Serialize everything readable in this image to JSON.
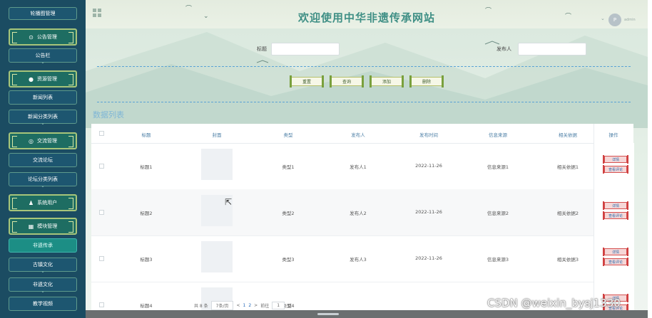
{
  "header": {
    "title": "欢迎使用中华非遗传承网站",
    "avatar_text": "P",
    "user_label": "admin"
  },
  "sidebar": {
    "items": [
      {
        "label": "轮播图管理",
        "type": "item"
      },
      {
        "label": "公告管理",
        "type": "group",
        "icon": "clock-icon"
      },
      {
        "label": "公告栏",
        "type": "item"
      },
      {
        "label": "资源管理",
        "type": "group",
        "icon": "location-pin-icon"
      },
      {
        "label": "新闻列表",
        "type": "item"
      },
      {
        "label": "新闻分类列表",
        "type": "item"
      },
      {
        "label": "交流管理",
        "type": "group",
        "icon": "chat-icon"
      },
      {
        "label": "交流论坛",
        "type": "item"
      },
      {
        "label": "论坛分类列表",
        "type": "item"
      },
      {
        "label": "系统用户",
        "type": "group",
        "icon": "user-icon"
      },
      {
        "label": "模块管理",
        "type": "group",
        "icon": "grid-icon"
      },
      {
        "label": "非遗传承",
        "type": "item",
        "active": true
      },
      {
        "label": "古镇文化",
        "type": "item"
      },
      {
        "label": "非遗文化",
        "type": "item"
      },
      {
        "label": "教学视频",
        "type": "item"
      }
    ]
  },
  "search": {
    "title_label": "标题",
    "title_value": "",
    "publisher_label": "发布人",
    "publisher_value": ""
  },
  "toolbar": {
    "reset_label": "重置",
    "search_label": "查询",
    "add_label": "添加",
    "delete_label": "删除"
  },
  "list": {
    "section_title": "数据列表",
    "columns": [
      "标题",
      "封面",
      "类型",
      "发布人",
      "发布时间",
      "信息来源",
      "相关依据",
      "操作"
    ],
    "rows": [
      {
        "title": "标题1",
        "type": "类型1",
        "publisher": "发布人1",
        "time": "2022-11-26",
        "source": "信息来源1",
        "basis": "相关依据1"
      },
      {
        "title": "标题2",
        "type": "类型2",
        "publisher": "发布人2",
        "time": "2022-11-26",
        "source": "信息来源2",
        "basis": "相关依据2"
      },
      {
        "title": "标题3",
        "type": "类型3",
        "publisher": "发布人3",
        "time": "2022-11-26",
        "source": "信息来源3",
        "basis": "相关依据3"
      },
      {
        "title": "标题4",
        "type": "类型4",
        "publisher": "",
        "time": "",
        "source": "",
        "basis": ""
      }
    ],
    "op_detail_label": "详情",
    "op_comment_label": "查看评论"
  },
  "pagination": {
    "total_text": "共 8 条",
    "page_size_text": "7条/页",
    "prev_text": "<",
    "pages": [
      "1",
      "2"
    ],
    "next_text": ">",
    "goto_label": "前往",
    "goto_value": "1",
    "page_suffix": "页"
  },
  "watermark": "CSDN @weixin_bysj1330"
}
